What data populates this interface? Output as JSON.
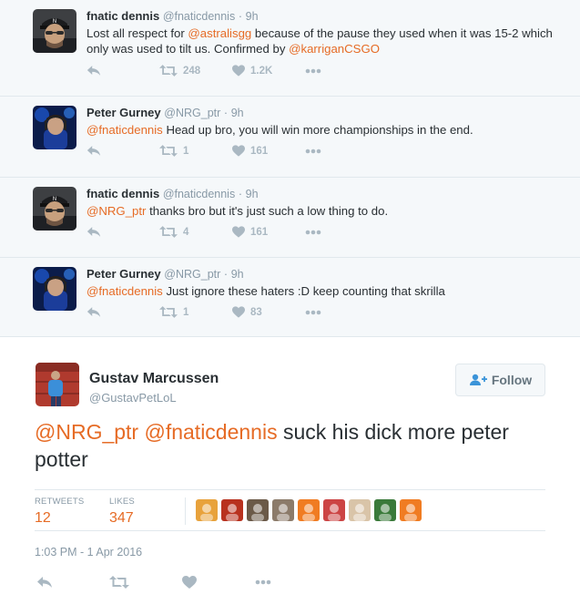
{
  "thread": [
    {
      "name": "fnatic dennis",
      "handle": "@fnaticdennis",
      "time": "9h",
      "text_parts": [
        {
          "t": "Lost all respect for ",
          "m": false
        },
        {
          "t": "@astralisgg",
          "m": true
        },
        {
          "t": " because of the pause they used when it was 15-2 which only was used to tilt us. Confirmed by ",
          "m": false
        },
        {
          "t": "@karriganCSGO",
          "m": true
        }
      ],
      "retweets": "248",
      "likes": "1.2K",
      "avatar": "fnatic-dennis"
    },
    {
      "name": "Peter Gurney",
      "handle": "@NRG_ptr",
      "time": "9h",
      "text_parts": [
        {
          "t": "@fnaticdennis",
          "m": true
        },
        {
          "t": "  Head up bro, you will win more championships in the end.",
          "m": false
        }
      ],
      "retweets": "1",
      "likes": "161",
      "avatar": "peter-gurney"
    },
    {
      "name": "fnatic dennis",
      "handle": "@fnaticdennis",
      "time": "9h",
      "text_parts": [
        {
          "t": "@NRG_ptr",
          "m": true
        },
        {
          "t": " thanks bro but it's just such a low thing to do.",
          "m": false
        }
      ],
      "retweets": "4",
      "likes": "161",
      "avatar": "fnatic-dennis"
    },
    {
      "name": "Peter Gurney",
      "handle": "@NRG_ptr",
      "time": "9h",
      "text_parts": [
        {
          "t": "@fnaticdennis",
          "m": true
        },
        {
          "t": " Just ignore these haters :D keep counting that skrilla",
          "m": false
        }
      ],
      "retweets": "1",
      "likes": "83",
      "avatar": "peter-gurney"
    }
  ],
  "main_tweet": {
    "name": "Gustav Marcussen",
    "handle": "@GustavPetLoL",
    "follow_label": "Follow",
    "text_parts": [
      {
        "t": "@NRG_ptr",
        "m": true
      },
      {
        "t": " ",
        "m": false
      },
      {
        "t": "@fnaticdennis",
        "m": true
      },
      {
        "t": " suck his dick more peter potter",
        "m": false
      }
    ],
    "retweets_label": "RETWEETS",
    "retweets": "12",
    "likes_label": "LIKES",
    "likes": "347",
    "timestamp": "1:03 PM - 1 Apr 2016",
    "likers": [
      "#e8a23c",
      "#b8321f",
      "#6b5a48",
      "#8c7b6a",
      "#f07c22",
      "#c44",
      "#d9c4a8",
      "#3a7a3a",
      "#f07c22"
    ]
  },
  "colors": {
    "mention": "#e66b25",
    "muted": "#8899a6",
    "icon": "#aab8c2",
    "thread_bg": "#f5f8fa"
  }
}
